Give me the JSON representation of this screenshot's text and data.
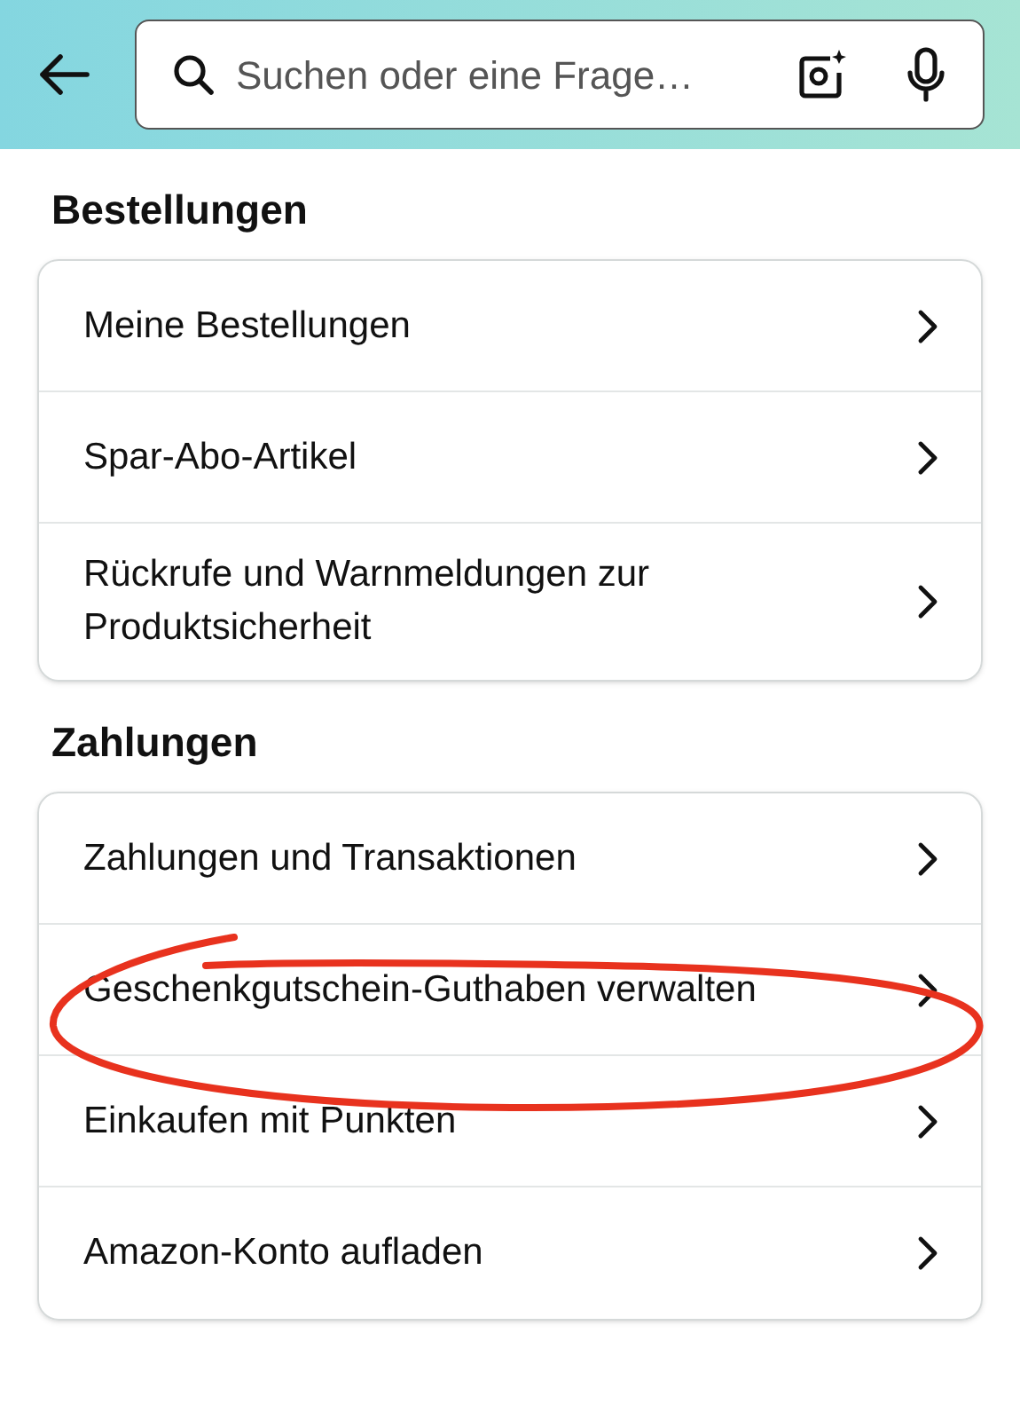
{
  "search": {
    "placeholder": "Suchen oder eine Frage…"
  },
  "sections": [
    {
      "title": "Bestellungen",
      "items": [
        "Meine Bestellungen",
        "Spar-Abo-Artikel",
        "Rückrufe und Warnmeldungen zur Produktsicherheit"
      ]
    },
    {
      "title": "Zahlungen",
      "items": [
        "Zahlungen und Transaktionen",
        "Geschenkgutschein-Guthaben verwalten",
        "Einkaufen mit Punkten",
        "Amazon-Konto aufladen"
      ]
    }
  ]
}
